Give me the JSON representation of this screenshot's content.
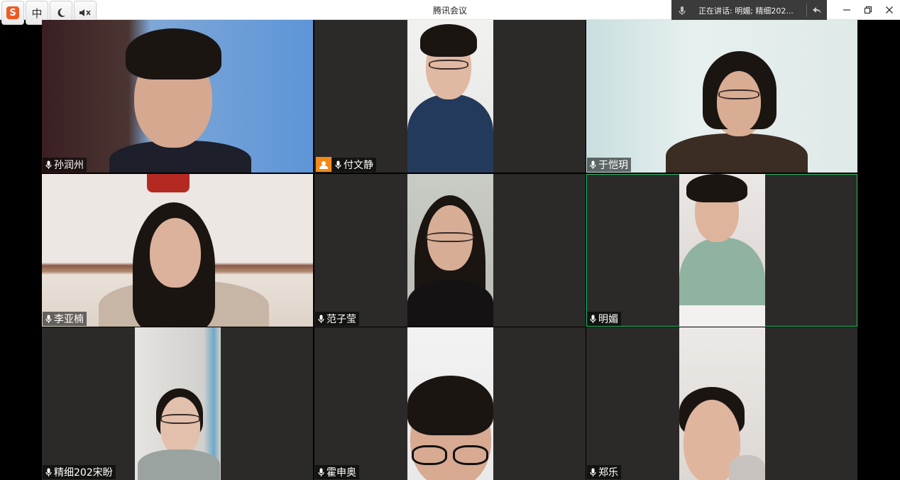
{
  "window": {
    "title": "腾讯会议",
    "speaking_label": "正在讲话: 明媚; 精细202...",
    "ime_chinese_label": "中"
  },
  "participants": [
    {
      "name": "孙润州"
    },
    {
      "name": "付文静"
    },
    {
      "name": "于恺玥"
    },
    {
      "name": "李亚楠"
    },
    {
      "name": "范子莹"
    },
    {
      "name": "明媚"
    },
    {
      "name": "精细202宋盼"
    },
    {
      "name": "霍申奥"
    },
    {
      "name": "郑乐"
    }
  ],
  "colors": {
    "active_border": "#1fbf6b",
    "tile_bg": "#2c2a28",
    "avatar_badge": "#f28a1a"
  }
}
